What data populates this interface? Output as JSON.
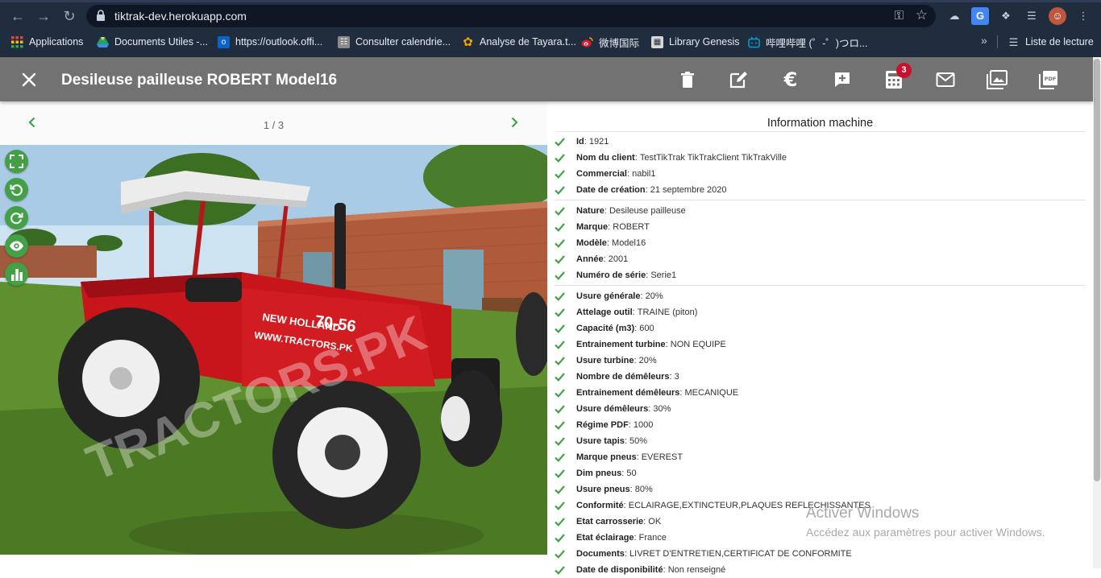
{
  "browser": {
    "url": "tiktrak-dev.herokuapp.com",
    "bookmarks": [
      {
        "label": "Applications",
        "icon": "apps-grid-icon",
        "color": "#e94235"
      },
      {
        "label": "Documents Utiles -...",
        "icon": "drive-icon",
        "color": "#1fa463"
      },
      {
        "label": "https://outlook.offi...",
        "icon": "outlook-icon",
        "color": "#0a64c8"
      },
      {
        "label": "Consulter calendrie...",
        "icon": "calendar-icon",
        "color": "#8a8a8a"
      },
      {
        "label": "Analyse de Tayara.t...",
        "icon": "tayara-icon",
        "color": "#f4a300"
      },
      {
        "label": "微博国际",
        "icon": "weibo-icon",
        "color": "#e6162d"
      },
      {
        "label": "Library Genesis",
        "icon": "library-icon",
        "color": "#d8d8d8"
      },
      {
        "label": "哔哩哔哩 (゜-゜)つロ...",
        "icon": "bilibili-icon",
        "color": "#00a1d6"
      }
    ],
    "more": "»",
    "reading_list": "Liste de lecture"
  },
  "header": {
    "title": "Desileuse pailleuse ROBERT Model16",
    "actions": [
      {
        "name": "delete",
        "icon": "trash-icon"
      },
      {
        "name": "edit",
        "icon": "edit-icon"
      },
      {
        "name": "price",
        "icon": "euro-icon"
      },
      {
        "name": "add-comment",
        "icon": "add-box-icon"
      },
      {
        "name": "calculator",
        "icon": "calculator-icon",
        "badge": "3"
      },
      {
        "name": "email",
        "icon": "mail-icon"
      },
      {
        "name": "photos",
        "icon": "photo-library-icon"
      },
      {
        "name": "pdf",
        "icon": "pdf-icon"
      }
    ]
  },
  "gallery": {
    "counter": "1 / 3",
    "tools": [
      "fullscreen-icon",
      "rotate-left-icon",
      "rotate-right-icon",
      "eye-icon",
      "chart-icon"
    ]
  },
  "info": {
    "title": "Information machine",
    "groups": [
      [
        {
          "label": "Id",
          "value": "1921"
        },
        {
          "label": "Nom du client",
          "value": "TestTikTrak TikTrakClient TikTrakVille"
        },
        {
          "label": "Commercial",
          "value": "nabil1"
        },
        {
          "label": "Date de création",
          "value": "21 septembre 2020"
        }
      ],
      [
        {
          "label": "Nature",
          "value": "Desileuse pailleuse"
        },
        {
          "label": "Marque",
          "value": "ROBERT"
        },
        {
          "label": "Modèle",
          "value": "Model16"
        },
        {
          "label": "Année",
          "value": "2001"
        },
        {
          "label": "Numéro de série",
          "value": "Serie1"
        }
      ],
      [
        {
          "label": "Usure générale",
          "value": "20%"
        },
        {
          "label": "Attelage outil",
          "value": "TRAINE (piton)"
        },
        {
          "label": "Capacité (m3)",
          "value": "600"
        },
        {
          "label": "Entrainement turbine",
          "value": "NON EQUIPE"
        },
        {
          "label": "Usure turbine",
          "value": "20%"
        },
        {
          "label": "Nombre de démêleurs",
          "value": "3"
        },
        {
          "label": "Entrainement démêleurs",
          "value": "MECANIQUE"
        },
        {
          "label": "Usure démêleurs",
          "value": "30%"
        },
        {
          "label": "Régime PDF",
          "value": "1000"
        },
        {
          "label": "Usure tapis",
          "value": "50%"
        },
        {
          "label": "Marque pneus",
          "value": "EVEREST"
        },
        {
          "label": "Dim pneus",
          "value": "50"
        },
        {
          "label": "Usure pneus",
          "value": "80%"
        },
        {
          "label": "Conformité",
          "value": "ECLAIRAGE,EXTINCTEUR,PLAQUES REFLECHISSANTES"
        },
        {
          "label": "Etat carrosserie",
          "value": "OK"
        },
        {
          "label": "Etat éclairage",
          "value": "France"
        },
        {
          "label": "Documents",
          "value": "LIVRET D'ENTRETIEN,CERTIFICAT DE CONFORMITE"
        },
        {
          "label": "Date de disponibilité",
          "value": "Non renseigné"
        }
      ]
    ]
  },
  "watermark": {
    "line1": "Activer Windows",
    "line2": "Accédez aux paramètres pour activer Windows."
  },
  "colors": {
    "accent_green": "#43a047",
    "header_grey": "#727272",
    "badge_red": "#c8102e",
    "browser_dark": "#202d3f"
  }
}
